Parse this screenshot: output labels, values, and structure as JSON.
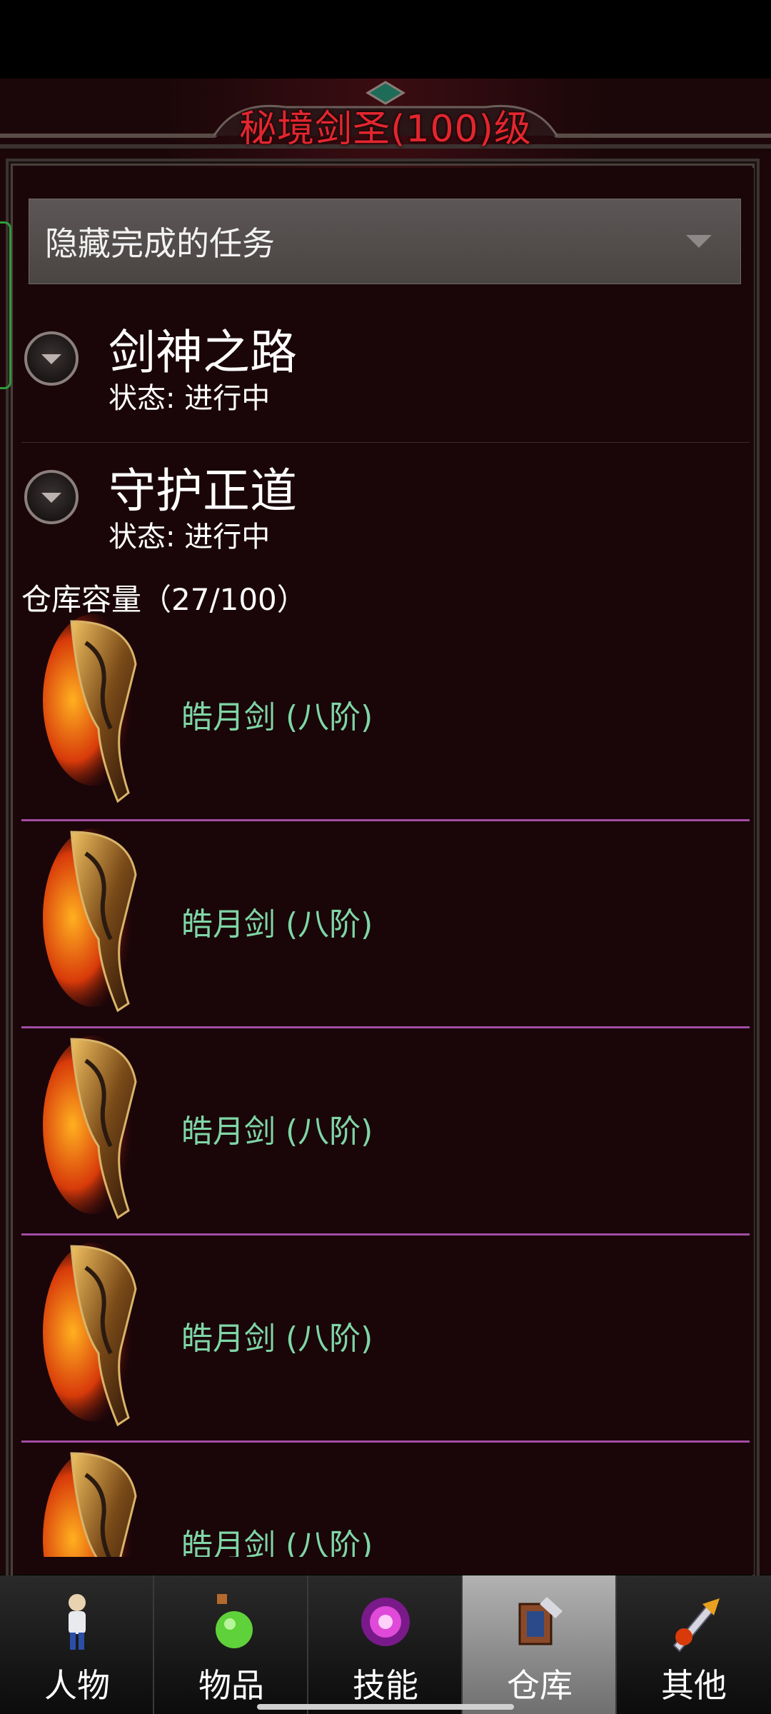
{
  "header": {
    "title": "秘境剑圣(100)级"
  },
  "quest_filter": {
    "selected": "隐藏完成的任务"
  },
  "quests": [
    {
      "title": "剑神之路",
      "status": "状态: 进行中"
    },
    {
      "title": "守护正道",
      "status": "状态: 进行中"
    }
  ],
  "warehouse": {
    "capacity_label": "仓库容量（27/100）",
    "items": [
      {
        "name": "皓月剑 (八阶)"
      },
      {
        "name": "皓月剑 (八阶)"
      },
      {
        "name": "皓月剑 (八阶)"
      },
      {
        "name": "皓月剑 (八阶)"
      },
      {
        "name": "皓月剑 (八阶)"
      }
    ]
  },
  "nav": {
    "tabs": [
      {
        "label": "人物",
        "icon": "character-icon"
      },
      {
        "label": "物品",
        "icon": "potion-icon"
      },
      {
        "label": "技能",
        "icon": "skill-orb-icon"
      },
      {
        "label": "仓库",
        "icon": "warehouse-icon",
        "active": true
      },
      {
        "label": "其他",
        "icon": "sword-icon"
      }
    ]
  },
  "colors": {
    "title": "#e2262f",
    "item_name": "#7fd6a6",
    "item_divider": "#a24da3",
    "background": "#1a0609"
  }
}
